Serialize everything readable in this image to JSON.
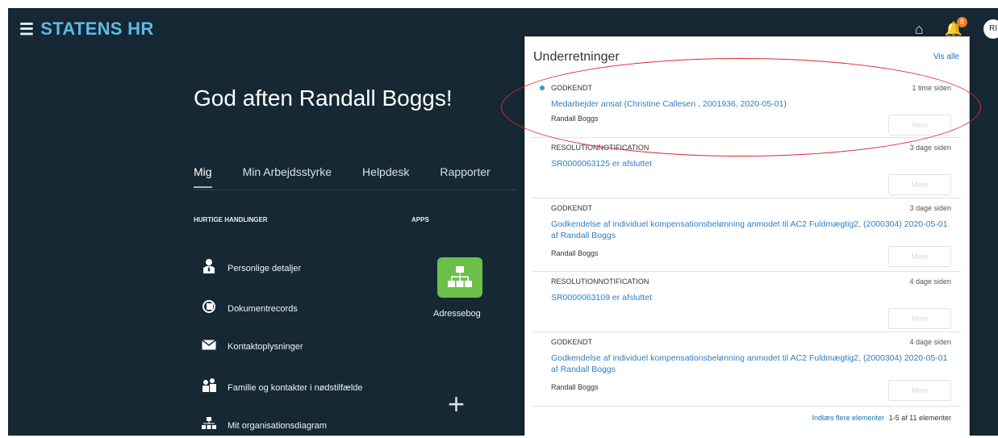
{
  "brand": {
    "title": "STATENS HR"
  },
  "header": {
    "badge_count": "8",
    "avatar_initials": "RI"
  },
  "greeting": "God aften Randall Boggs!",
  "tabs": [
    {
      "label": "Mig"
    },
    {
      "label": "Min Arbejdsstyrke"
    },
    {
      "label": "Helpdesk"
    },
    {
      "label": "Rapporter"
    }
  ],
  "sections": {
    "quick_actions": "HURTIGE HANDLINGER",
    "apps": "APPS"
  },
  "quick_actions": [
    {
      "label": "Personlige detaljer",
      "icon": "person-icon"
    },
    {
      "label": "Dokumentrecords",
      "icon": "document-records-icon"
    },
    {
      "label": "Kontaktoplysninger",
      "icon": "envelope-icon"
    },
    {
      "label": "Familie og kontakter i nødstilfælde",
      "icon": "family-icon"
    },
    {
      "label": "Mit organisationsdiagram",
      "icon": "org-chart-icon"
    }
  ],
  "apps": [
    {
      "label": "Adressebog",
      "icon": "org-chart-icon",
      "color": "#6cc04a"
    }
  ],
  "panel": {
    "title": "Underretninger",
    "show_all": "Vis alle",
    "notifications": [
      {
        "type": "GODKENDT",
        "time": "1 time siden",
        "message": "Medarbejder ansat (Christine Callesen , 2001936, 2020-05-01)",
        "user": "Randall Boggs",
        "button": "Mere",
        "unread": true
      },
      {
        "type": "RESOLUTIONNOTIFICATION",
        "time": "3 dage siden",
        "message": "SR0000063125 er afsluttet",
        "user": "",
        "button": "Mere",
        "unread": false
      },
      {
        "type": "GODKENDT",
        "time": "3 dage siden",
        "message": "Godkendelse af individuel kompensationsbelønning anmodet til AC2 Fuldmægtig2, (2000304) 2020-05-01 af Randall Boggs",
        "user": "Randall Boggs",
        "button": "Mere",
        "unread": false
      },
      {
        "type": "RESOLUTIONNOTIFICATION",
        "time": "4 dage siden",
        "message": "SR0000063109 er afsluttet",
        "user": "",
        "button": "Mere",
        "unread": false
      },
      {
        "type": "GODKENDT",
        "time": "4 dage siden",
        "message": "Godkendelse af individuel kompensationsbelønning anmodet til AC2 Fuldmægtig2, (2000304) 2020-05-01 af Randall Boggs",
        "user": "Randall Boggs",
        "button": "Mere",
        "unread": false
      }
    ],
    "load_more": "Indlæs flere elementer",
    "count": "1-5 af 11 elementer"
  },
  "colors": {
    "header_bg": "#152834",
    "brand": "#5fb8e6",
    "link": "#2f7ec2",
    "badge": "#f07a22",
    "highlight": "#e0262f"
  }
}
